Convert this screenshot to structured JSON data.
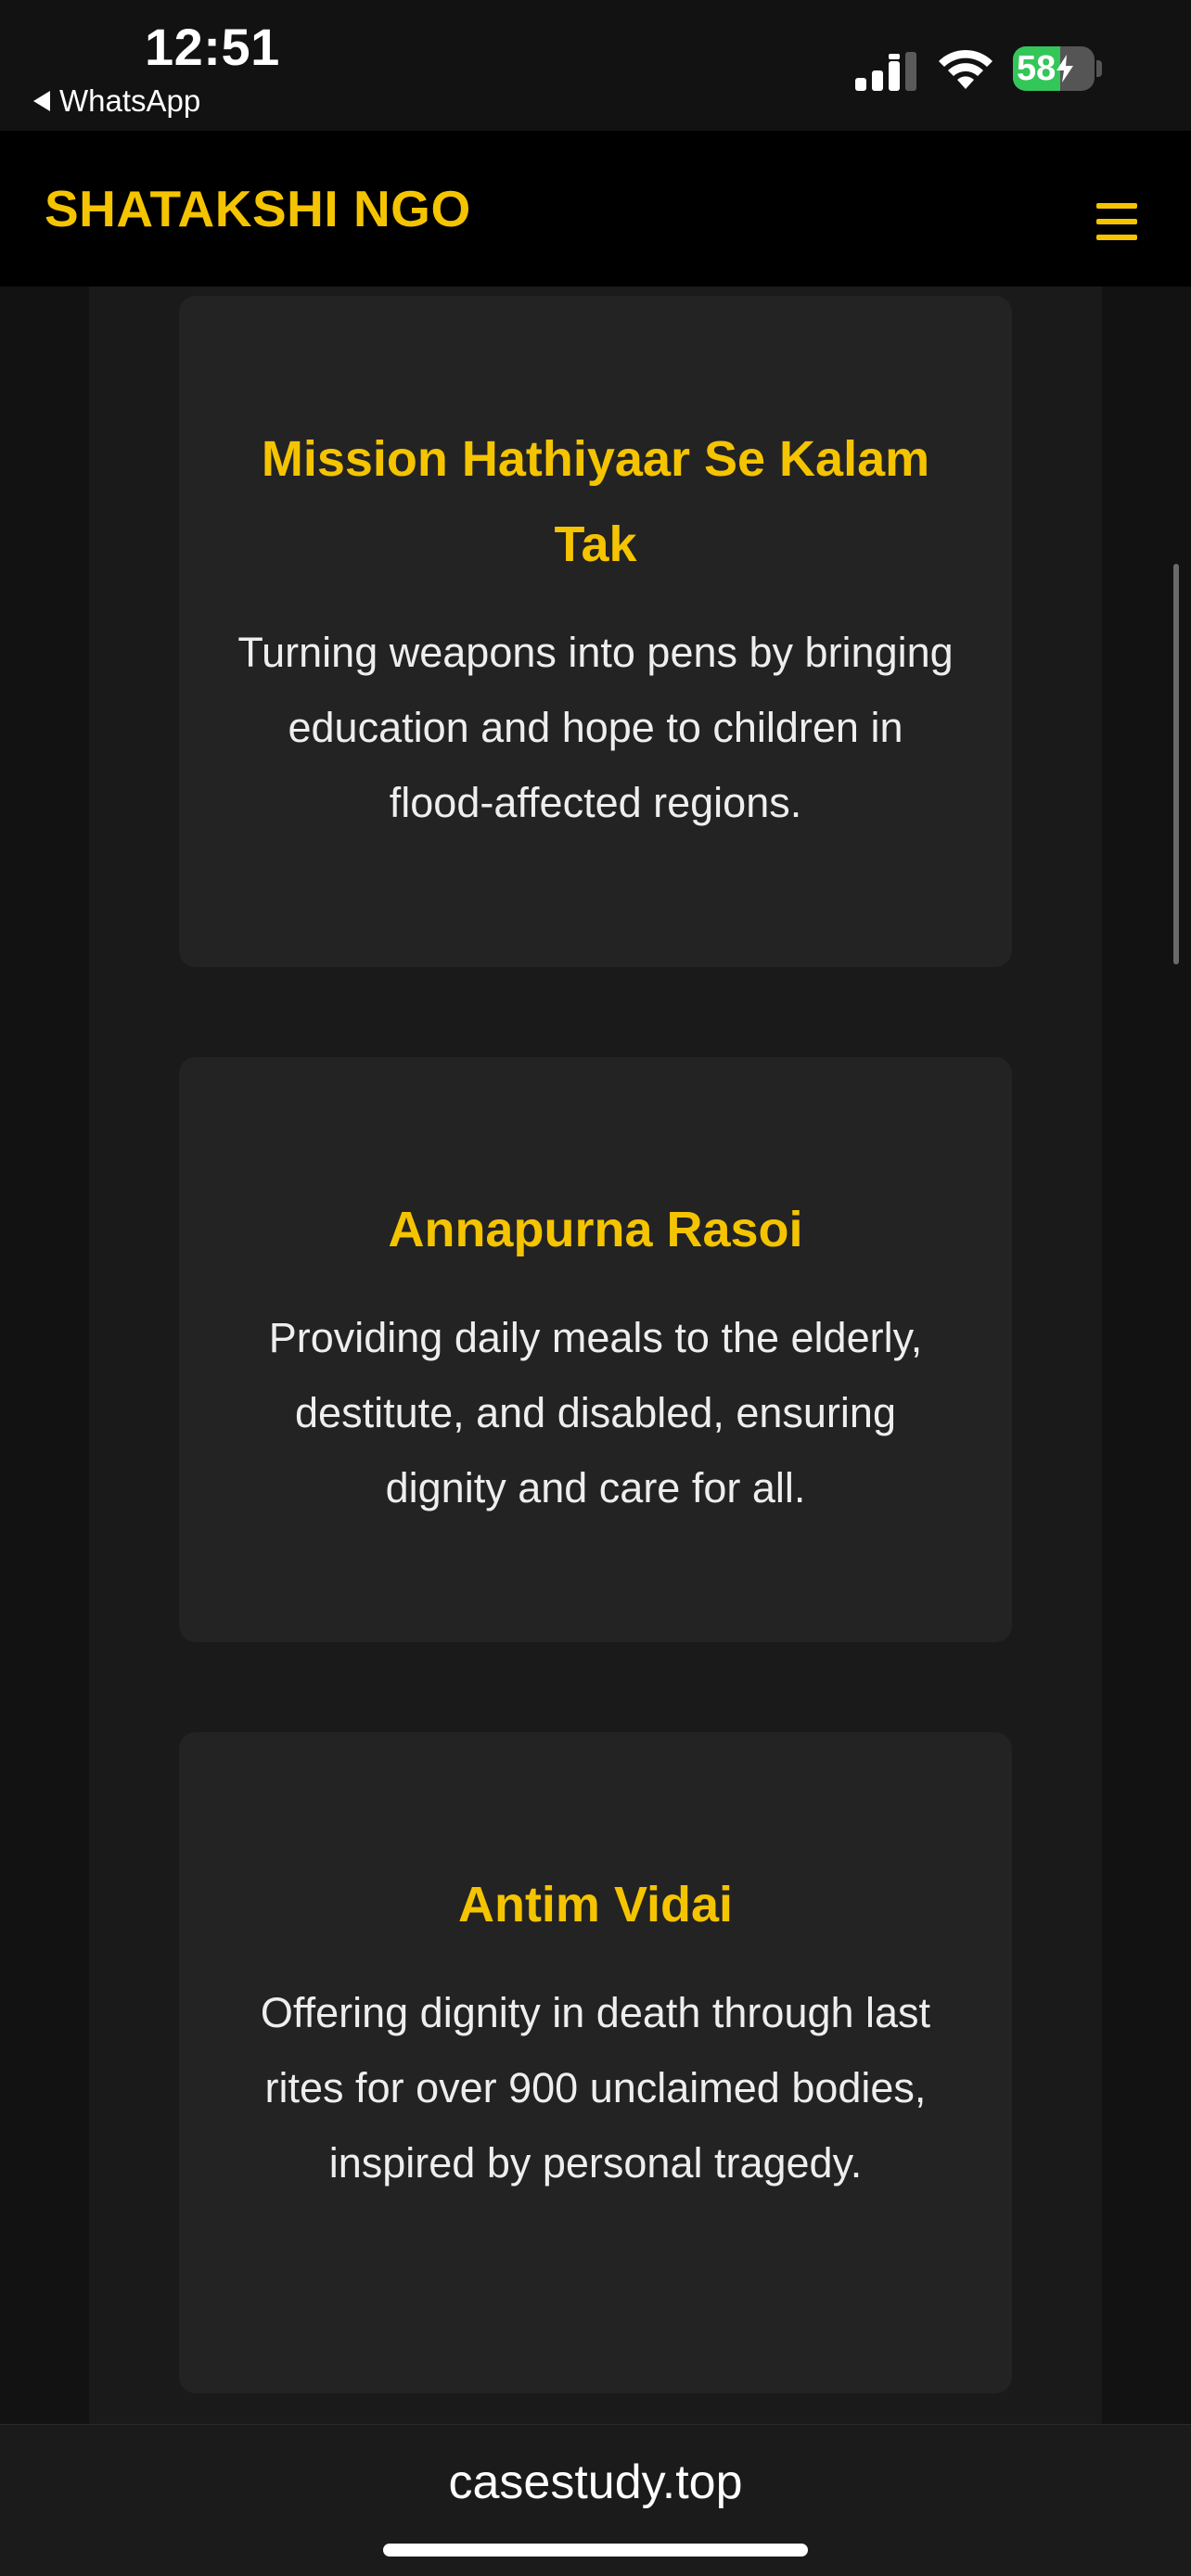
{
  "status_bar": {
    "time": "12:51",
    "back_label": "WhatsApp",
    "battery_level": "58",
    "battery_fraction": 0.58,
    "icons": [
      "signal-icon",
      "wifi-icon",
      "battery-icon",
      "charging-bolt-icon"
    ]
  },
  "header": {
    "logo": "SHATAKSHI NGO",
    "menu_icon": "hamburger-menu-icon",
    "accent_color": "#f5c400"
  },
  "cards": [
    {
      "title": "Mission Hathiyaar Se Kalam Tak",
      "description": "Turning weapons into pens by bringing education and hope to children in flood-affected regions."
    },
    {
      "title": "Annapurna Rasoi",
      "description": "Providing daily meals to the elderly, destitute, and disabled, ensuring dignity and care for all."
    },
    {
      "title": "Antim Vidai",
      "description": "Offering dignity in death through last rites for over 900 unclaimed bodies, inspired by personal tragedy."
    }
  ],
  "browser": {
    "url": "casestudy.top"
  },
  "colors": {
    "background": "#121212",
    "card": "#232323",
    "title": "#f5c400",
    "text": "#eeeeee"
  }
}
